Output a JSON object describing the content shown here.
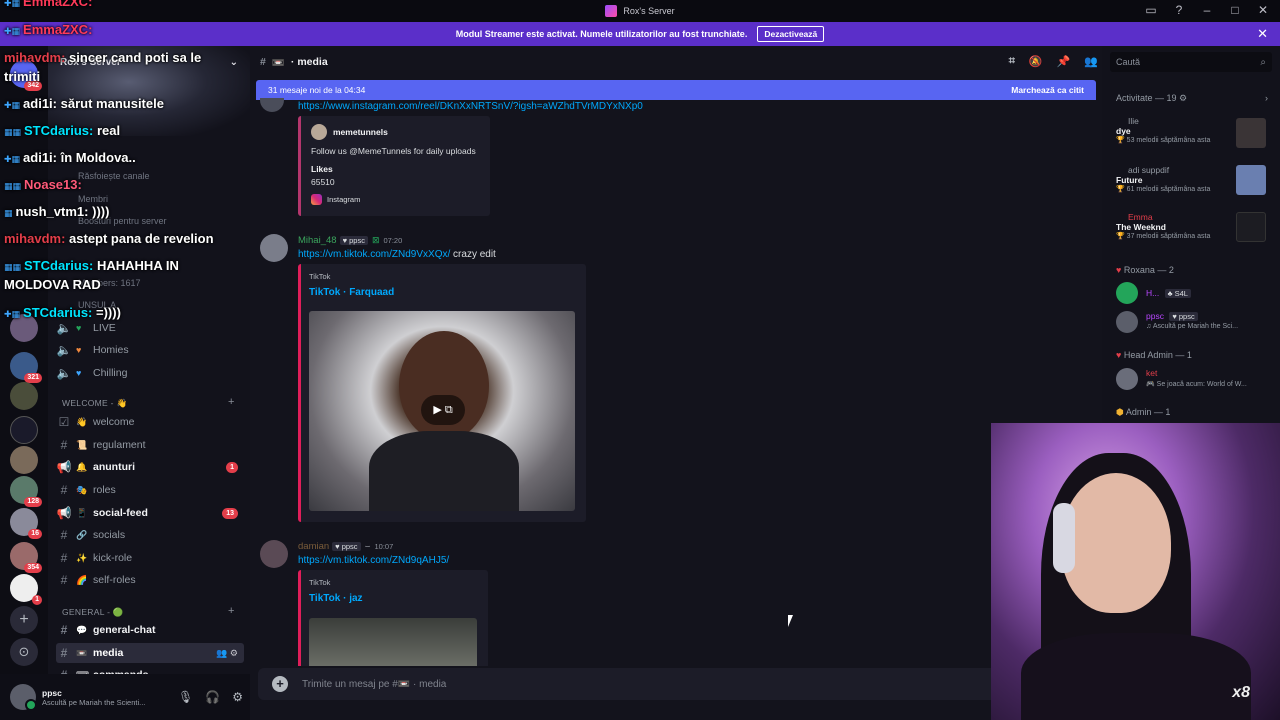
{
  "window": {
    "title": "Rox's Server"
  },
  "banner": {
    "text": "Modul Streamer este activat. Numele utilizatorilor au fost trunchiate.",
    "button": "Dezactivează"
  },
  "server": {
    "name": "Rox's Server"
  },
  "sidebar": {
    "dim_items": [
      "Răsfoiește canale",
      "Membri",
      "Boosturi pentru server",
      "Members: 1617",
      "UNSUL A"
    ],
    "voice": [
      {
        "label": "LIVE",
        "heart": "#23a55a"
      },
      {
        "label": "Homies",
        "heart": "#f0883e"
      },
      {
        "label": "Chilling",
        "heart": "#3ea6ff"
      }
    ],
    "cat_welcome": "WELCOME - 👋",
    "welcome_channels": [
      {
        "emoji": "👋",
        "label": "welcome",
        "bold": false,
        "count": ""
      },
      {
        "emoji": "📜",
        "label": "regulament",
        "bold": false,
        "count": ""
      },
      {
        "emoji": "🔔",
        "label": "anunturi",
        "bold": true,
        "count": "1"
      },
      {
        "emoji": "🎭",
        "label": "roles",
        "bold": false,
        "count": ""
      },
      {
        "emoji": "📱",
        "label": "social-feed",
        "bold": true,
        "count": "13"
      },
      {
        "emoji": "🔗",
        "label": "socials",
        "bold": false,
        "count": ""
      },
      {
        "emoji": "✨",
        "label": "kick-role",
        "bold": false,
        "count": ""
      },
      {
        "emoji": "🌈",
        "label": "self-roles",
        "bold": false,
        "count": ""
      }
    ],
    "cat_general": "GENERAL - 🟢",
    "general_channels": [
      {
        "emoji": "💬",
        "label": "general-chat",
        "bold": true
      },
      {
        "emoji": "📼",
        "label": "media",
        "bold": true,
        "active": true
      },
      {
        "emoji": "⌨",
        "label": "commands",
        "bold": true
      }
    ]
  },
  "rail": {
    "badges": [
      "342",
      "321",
      "128",
      "16",
      "354",
      "1"
    ]
  },
  "user": {
    "name": "ppsc",
    "status": "Ascultă pe Mariah the Scienti..."
  },
  "chat": {
    "channel": "media",
    "newbar_left": "31 mesaje noi de la 04:34",
    "newbar_right": "Marchează ca citit",
    "msg0_link": "https://www.instagram.com/reel/DKnXxNRTSnV/?igsh=aWZhdTVrMDYxNXp0",
    "insta": {
      "author": "memetunnels",
      "desc": "Follow us @MemeTunnels for daily uploads",
      "likes_label": "Likes",
      "likes": "65510",
      "provider": "Instagram"
    },
    "msg1": {
      "author": "Mihai_48",
      "tag": "ppsc",
      "time": "07:20",
      "link": "https://vm.tiktok.com/ZNd9VxXQx/",
      "text": "crazy edit",
      "provider": "TikTok",
      "title": "TikTok · Farquaad"
    },
    "msg2": {
      "author": "damian",
      "tag": "ppsc",
      "time": "10:07",
      "link": "https://vm.tiktok.com/ZNd9qAHJ5/",
      "provider": "TikTok",
      "title": "TikTok · jaz"
    },
    "composer_placeholder": "Trimite un mesaj pe #📼 · media"
  },
  "members": {
    "search_placeholder": "Caută",
    "activity_header": "Activitate — 19",
    "activity": [
      {
        "name": "Ilie",
        "name_color": "#949ba4",
        "song": "dye",
        "note": "53 melodii săptămâna asta",
        "thumb": "#3a3436"
      },
      {
        "name": "adi suppdif",
        "name_color": "#949ba4",
        "song": "Future",
        "note": "61 melodii săptămâna asta",
        "thumb": "#6a7fb0"
      },
      {
        "name": "Emma",
        "name_color": "#e33e4a",
        "song": "The Weeknd",
        "note": "37 melodii săptămâna asta",
        "thumb": "#1c1c22"
      }
    ],
    "roxana_header": "Roxana — 2",
    "roxana": [
      {
        "name": "H...",
        "tag": "S4L",
        "note": ""
      },
      {
        "name": "ppsc",
        "tag": "ppsc",
        "note": "Ascultă pe Mariah the Sci..."
      }
    ],
    "head_admin_header": "Head Admin — 1",
    "head_admin": {
      "name": "ket",
      "note": "Se joacă acum: World of W..."
    },
    "admin_header": "Admin — 1"
  },
  "overlay": [
    {
      "name": "EmmaZXC:",
      "color": "#ff3a5a",
      "text": ""
    },
    {
      "name": "EmmaZXC:",
      "color": "#ff3a5a",
      "text": ""
    },
    {
      "name": "mihavdm:",
      "color": "#e33e4a",
      "text": "sincer cand poti sa le"
    },
    {
      "name": "",
      "color": "#fff",
      "text": "trimiti"
    },
    {
      "name": "adi1i:",
      "color": "#ffffff",
      "text": "sărut manusitele"
    },
    {
      "name": "STCdarius:",
      "color": "#00e5ff",
      "text": "real"
    },
    {
      "name": "adi1i:",
      "color": "#ffffff",
      "text": "în Moldova.."
    },
    {
      "name": "Noase13:",
      "color": "#ff5a7a",
      "text": ""
    },
    {
      "name": "nush_vtm1:",
      "color": "#ffffff",
      "text": "))))"
    },
    {
      "name": "mihavdm:",
      "color": "#e33e4a",
      "text": "astept pana de revelion"
    },
    {
      "name": "STCdarius:",
      "color": "#00e5ff",
      "text": "HAHAHHA IN"
    },
    {
      "name": "",
      "color": "#fff",
      "text": "MOLDOVA RAD"
    },
    {
      "name": "STCdarius:",
      "color": "#00e5ff",
      "text": "=))))"
    }
  ],
  "cam": {
    "overlay_text": "x8"
  }
}
